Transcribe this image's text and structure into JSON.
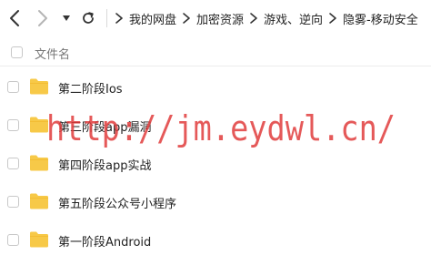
{
  "icons": {
    "back": "chevron-left-icon",
    "forward": "chevron-right-icon",
    "history": "caret-down-icon",
    "refresh": "refresh-icon",
    "breadcrumb_separator": "chevron-right-icon",
    "folder": "folder-icon"
  },
  "colors": {
    "folder": "#f7c948",
    "watermark": "#e03c3c",
    "nav_icon": "#333333",
    "nav_icon_disabled": "#b5b5b5"
  },
  "breadcrumb": [
    {
      "label": "我的网盘"
    },
    {
      "label": "加密资源"
    },
    {
      "label": "游戏、逆向"
    },
    {
      "label": "隐雾-移动安全"
    }
  ],
  "list": {
    "column_header": "文件名",
    "items": [
      {
        "name": "第二阶段Ios"
      },
      {
        "name": "第三阶段app漏洞"
      },
      {
        "name": "第四阶段app实战"
      },
      {
        "name": "第五阶段公众号小程序"
      },
      {
        "name": "第一阶段Android"
      }
    ]
  },
  "watermark": {
    "text": "http://jm.eydwl.cn/"
  }
}
